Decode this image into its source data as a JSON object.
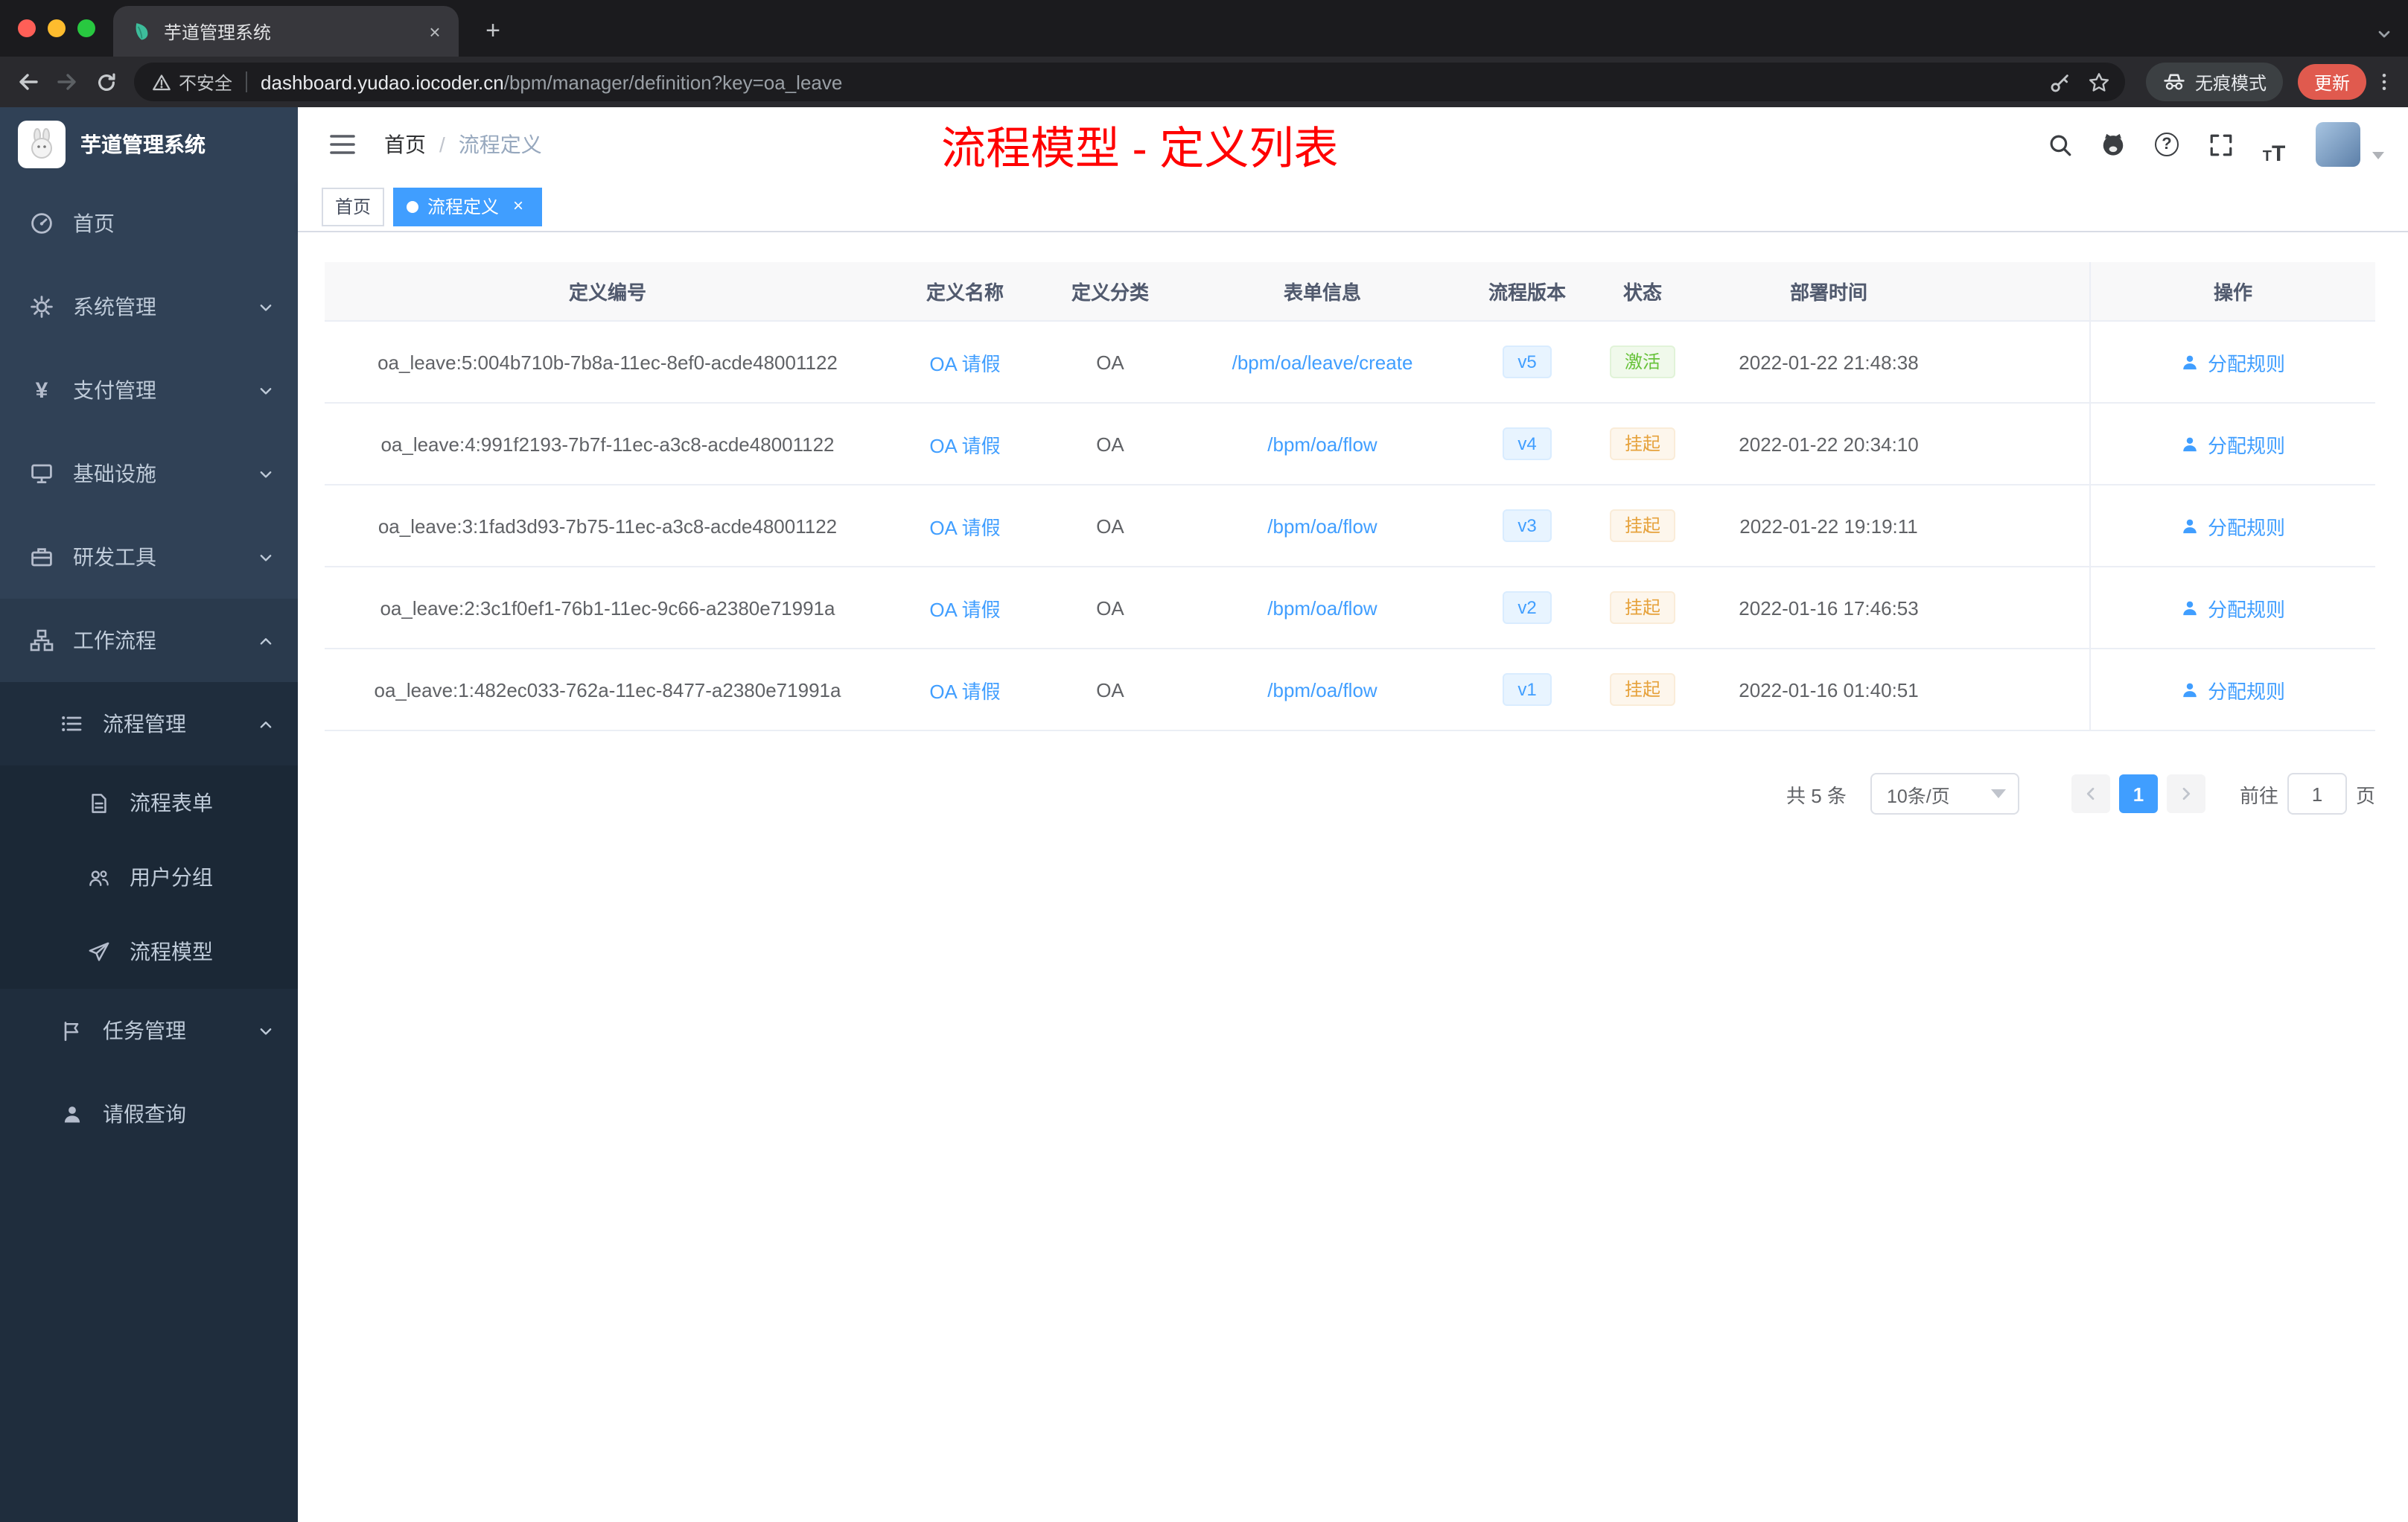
{
  "browser": {
    "tab_title": "芋道管理系统",
    "security_label": "不安全",
    "url_domain": "dashboard.yudao.iocoder.cn",
    "url_path": "/bpm/manager/definition?key=oa_leave",
    "incognito_label": "无痕模式",
    "update_label": "更新"
  },
  "icons": {
    "close": "×",
    "plus": "+",
    "question": "?",
    "font_small": "T",
    "font_large": "T"
  },
  "sidebar": {
    "logo_title": "芋道管理系统",
    "items": [
      {
        "label": "首页"
      },
      {
        "label": "系统管理"
      },
      {
        "label": "支付管理"
      },
      {
        "label": "基础设施"
      },
      {
        "label": "研发工具"
      },
      {
        "label": "工作流程"
      },
      {
        "label": "流程管理"
      },
      {
        "label": "流程表单"
      },
      {
        "label": "用户分组"
      },
      {
        "label": "流程模型"
      },
      {
        "label": "任务管理"
      },
      {
        "label": "请假查询"
      }
    ]
  },
  "navbar": {
    "breadcrumb": {
      "home": "首页",
      "separator": "/",
      "current": "流程定义"
    },
    "annotation": "流程模型 - 定义列表"
  },
  "tags": {
    "home": "首页",
    "active": "流程定义"
  },
  "table": {
    "headers": [
      "定义编号",
      "定义名称",
      "定义分类",
      "表单信息",
      "流程版本",
      "状态",
      "部署时间",
      "操作"
    ],
    "rows": [
      {
        "id": "oa_leave:5:004b710b-7b8a-11ec-8ef0-acde48001122",
        "name": "OA 请假",
        "category": "OA",
        "form": "/bpm/oa/leave/create",
        "version": "v5",
        "status": "激活",
        "deploy_time": "2022-01-22 21:48:38",
        "action": "分配规则"
      },
      {
        "id": "oa_leave:4:991f2193-7b7f-11ec-a3c8-acde48001122",
        "name": "OA 请假",
        "category": "OA",
        "form": "/bpm/oa/flow",
        "version": "v4",
        "status": "挂起",
        "deploy_time": "2022-01-22 20:34:10",
        "action": "分配规则"
      },
      {
        "id": "oa_leave:3:1fad3d93-7b75-11ec-a3c8-acde48001122",
        "name": "OA 请假",
        "category": "OA",
        "form": "/bpm/oa/flow",
        "version": "v3",
        "status": "挂起",
        "deploy_time": "2022-01-22 19:19:11",
        "action": "分配规则"
      },
      {
        "id": "oa_leave:2:3c1f0ef1-76b1-11ec-9c66-a2380e71991a",
        "name": "OA 请假",
        "category": "OA",
        "form": "/bpm/oa/flow",
        "version": "v2",
        "status": "挂起",
        "deploy_time": "2022-01-16 17:46:53",
        "action": "分配规则"
      },
      {
        "id": "oa_leave:1:482ec033-762a-11ec-8477-a2380e71991a",
        "name": "OA 请假",
        "category": "OA",
        "form": "/bpm/oa/flow",
        "version": "v1",
        "status": "挂起",
        "deploy_time": "2022-01-16 01:40:51",
        "action": "分配规则"
      }
    ]
  },
  "pagination": {
    "total": "共 5 条",
    "page_size": "10条/页",
    "current_page": "1",
    "goto_label": "前往",
    "goto_value": "1",
    "goto_unit": "页"
  },
  "colors": {
    "accent": "#409eff",
    "success": "#67c23a",
    "warning": "#e6a23c",
    "annotation_red": "#ff0000",
    "sidebar_bg": "#304156",
    "submenu_bg": "#1f2d3d",
    "table_header_bg": "#f8f8f9"
  }
}
